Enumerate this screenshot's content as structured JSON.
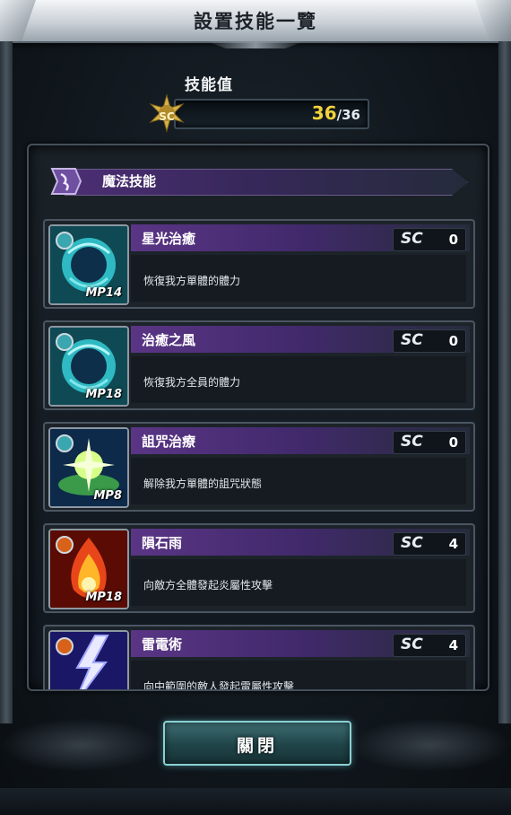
{
  "title": "設置技能一覽",
  "skill_points": {
    "label": "技能值",
    "icon_text": "SC",
    "current": "36",
    "max": "/36"
  },
  "category": {
    "title": "魔法技能"
  },
  "sc_label": "SC",
  "skills": [
    {
      "name": "星光治癒",
      "sc": "0",
      "mp": "MP14",
      "desc": "恢復我方單體的體力",
      "element": "water"
    },
    {
      "name": "治癒之風",
      "sc": "0",
      "mp": "MP18",
      "desc": "恢復我方全員的體力",
      "element": "water"
    },
    {
      "name": "詛咒治療",
      "sc": "0",
      "mp": "MP8",
      "desc": "解除我方單體的詛咒狀態",
      "element": "wind"
    },
    {
      "name": "隕石雨",
      "sc": "4",
      "mp": "MP18",
      "desc": "向敵方全體發起炎屬性攻擊",
      "element": "fire"
    },
    {
      "name": "雷電術",
      "sc": "4",
      "mp": "",
      "desc": "向中範圍的敵人發起雷屬性攻擊",
      "element": "thunder"
    }
  ],
  "close_button": "關閉",
  "colors": {
    "accent_purple": "#5a3585",
    "sc_current": "#f3d23a",
    "button_cyan": "#8bd0d3"
  }
}
